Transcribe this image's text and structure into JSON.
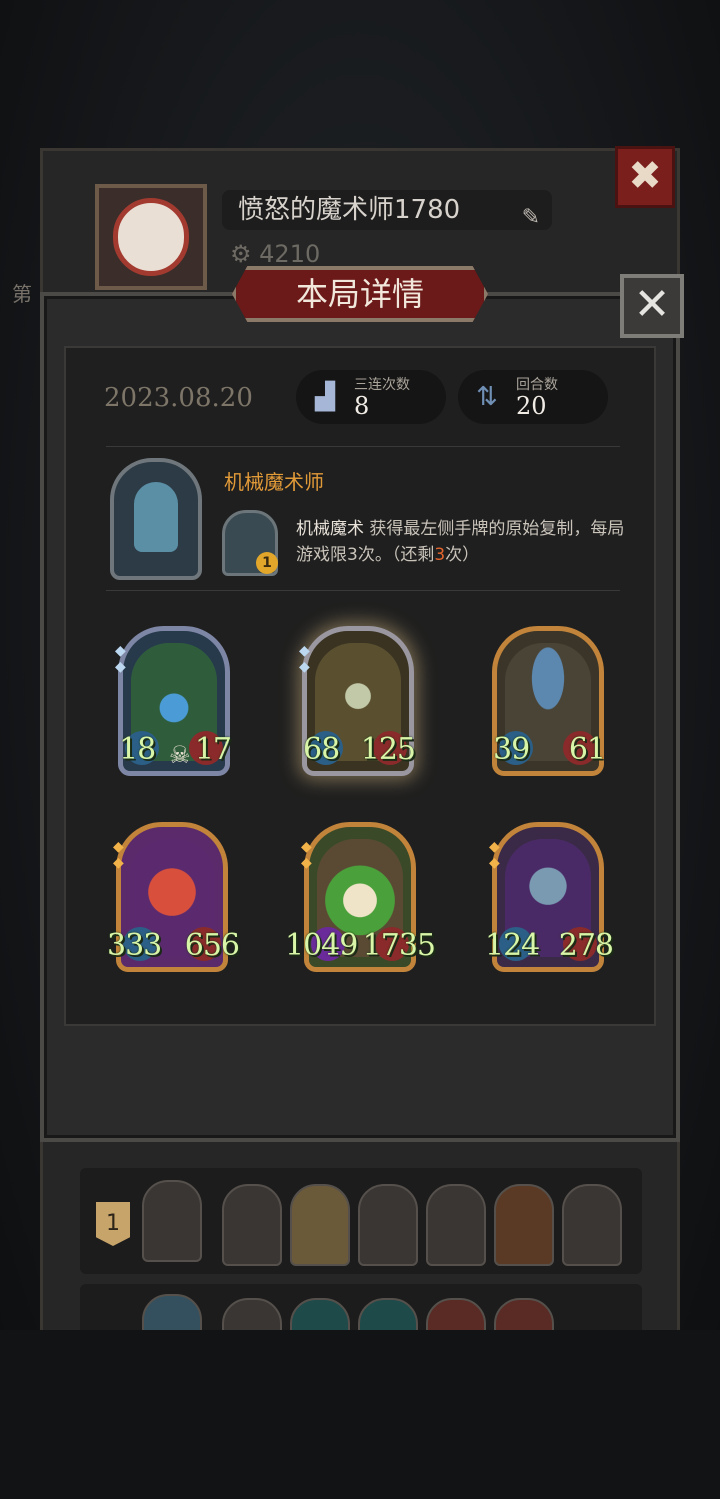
{
  "profile": {
    "name": "愤怒的魔术师1780",
    "coins": "4210",
    "left_label": "第"
  },
  "modal": {
    "title": "本局详情",
    "date": "2023.08.20",
    "stats": [
      {
        "label": "三连次数",
        "value": "8",
        "icon": "triple-cards-icon"
      },
      {
        "label": "回合数",
        "value": "20",
        "icon": "rounds-cycle-icon"
      }
    ],
    "hero": {
      "name": "机械魔术师",
      "skill_level": "1",
      "skill_name": "机械魔术",
      "skill_text_pre": "获得最左侧手牌的原始复制，每局游戏限3次。（还剩",
      "skill_remaining": "3",
      "skill_text_post": "次）"
    },
    "units": [
      {
        "atk": "18",
        "hp": "17",
        "frame": "silver",
        "art": "vine-plant"
      },
      {
        "atk": "68",
        "hp": "125",
        "frame": "silver",
        "art": "witch",
        "selected": true
      },
      {
        "atk": "39",
        "hp": "61",
        "frame": "gold",
        "art": "mushroom-spider"
      },
      {
        "atk": "333",
        "hp": "656",
        "frame": "gold",
        "art": "red-goblin"
      },
      {
        "atk": "1049",
        "hp": "1735",
        "frame": "gold",
        "art": "leaf-girl"
      },
      {
        "atk": "124",
        "hp": "278",
        "frame": "gold",
        "art": "elf-mage"
      }
    ]
  },
  "leaderboard": {
    "rank": "1"
  },
  "colors": {
    "accent_orange": "#e19a38",
    "title_red": "#6b1a19",
    "stat_green": "#d8f5a8"
  }
}
